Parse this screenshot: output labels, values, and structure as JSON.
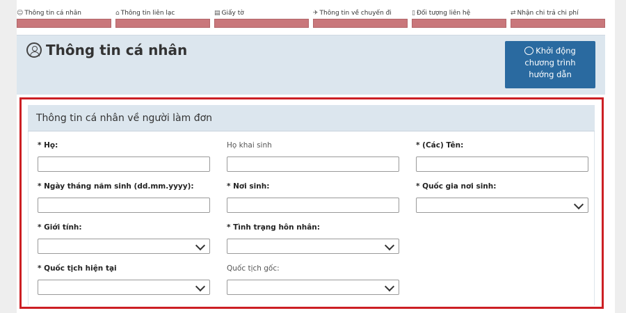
{
  "steps": [
    {
      "label": "Thông tin cá nhân",
      "icon": "person-circle-icon",
      "glyph": "☺"
    },
    {
      "label": "Thông tin liên lạc",
      "icon": "contact-icon",
      "glyph": "⌂"
    },
    {
      "label": "Giấy tờ",
      "icon": "document-icon",
      "glyph": "▤"
    },
    {
      "label": "Thông tin về chuyến đi",
      "icon": "travel-icon",
      "glyph": "✈"
    },
    {
      "label": "Đối tượng liên hệ",
      "icon": "contact-card-icon",
      "glyph": "▯"
    },
    {
      "label": "Nhận chi trả chi phí",
      "icon": "payment-icon",
      "glyph": "⇄"
    }
  ],
  "header": {
    "title": "Thông tin cá nhân",
    "guide_button": {
      "line1": "Khởi động",
      "line2": "chương trình",
      "line3": "hướng dẫn"
    }
  },
  "section": {
    "title": "Thông tin cá nhân về người làm đơn",
    "fields": {
      "ho": {
        "label": "* Họ:",
        "value": ""
      },
      "ho_khai_sinh": {
        "label": "Họ khai sinh",
        "value": ""
      },
      "ten": {
        "label": "* (Các) Tên:",
        "value": ""
      },
      "ngay_sinh": {
        "label": "* Ngày tháng năm sinh (dd.mm.yyyy):",
        "value": ""
      },
      "noi_sinh": {
        "label": "* Nơi sinh:",
        "value": ""
      },
      "quoc_gia_noi_sinh": {
        "label": "* Quốc gia nơi sinh:",
        "value": ""
      },
      "gioi_tinh": {
        "label": "* Giới tính:",
        "value": ""
      },
      "hon_nhan": {
        "label": "* Tình trạng hôn nhân:",
        "value": ""
      },
      "quoc_tich_hien_tai": {
        "label": "* Quốc tịch hiện tại",
        "value": ""
      },
      "quoc_tich_goc": {
        "label": "Quốc tịch gốc:",
        "value": ""
      }
    }
  },
  "colors": {
    "step_bar": "#c9777b",
    "header_bg": "#dce6ee",
    "guide_button": "#2a6aa0",
    "frame_border": "#cc1f24"
  }
}
